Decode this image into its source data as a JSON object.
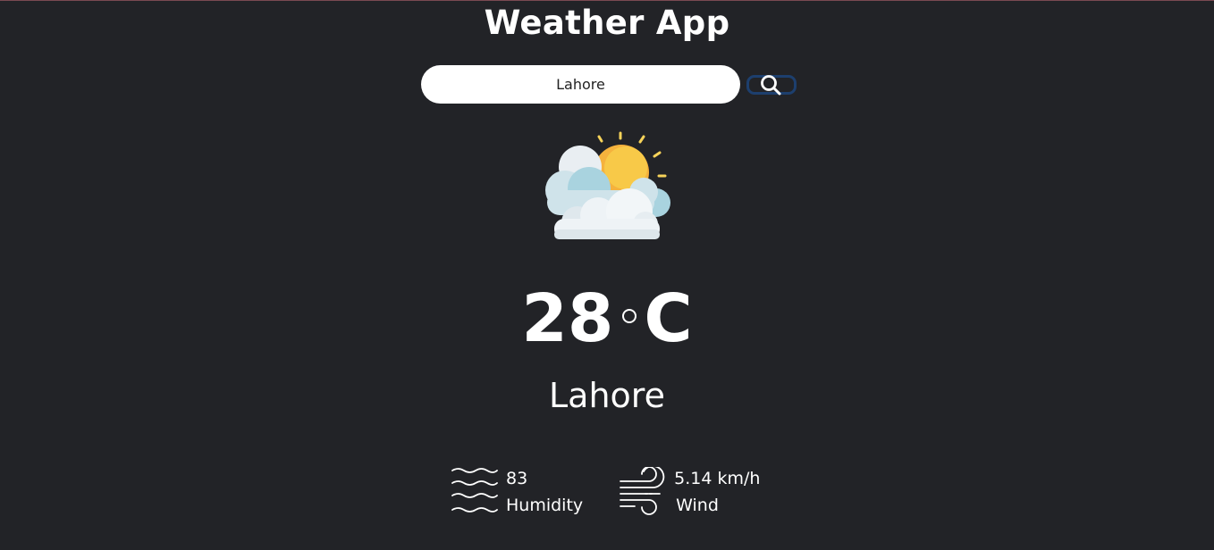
{
  "app": {
    "title": "Weather App"
  },
  "search": {
    "value": "Lahore",
    "icon": "search-icon"
  },
  "weather": {
    "icon": "partly-cloudy-icon",
    "temperature": "28",
    "unit": "C",
    "city": "Lahore"
  },
  "details": {
    "humidity": {
      "value": "83",
      "label": "Humidity",
      "icon": "humidity-waves-icon"
    },
    "wind": {
      "value": "5.14 km/h",
      "label": "Wind",
      "icon": "wind-icon"
    }
  },
  "colors": {
    "background": "#222327",
    "search_button_border": "#1d3f6e",
    "text": "#ffffff"
  }
}
